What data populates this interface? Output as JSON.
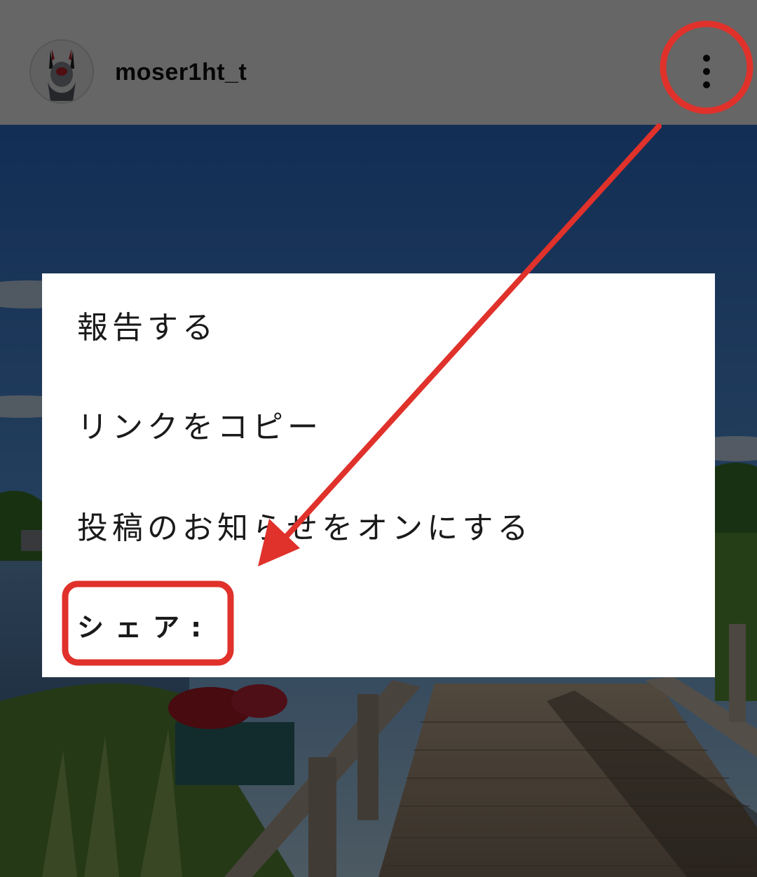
{
  "post_header": {
    "username": "moser1ht_t",
    "avatar_icon": "demon-avatar-icon",
    "more_icon": "vertical-dots-icon"
  },
  "menu": {
    "items": [
      {
        "label": "報告する"
      },
      {
        "label": "リンクをコピー"
      },
      {
        "label": "投稿のお知らせをオンにする"
      },
      {
        "label": "シェア:"
      }
    ]
  },
  "annotation": {
    "color": "#e0312b"
  },
  "photo": {
    "subject": "wooden-boardwalk-by-lake"
  }
}
